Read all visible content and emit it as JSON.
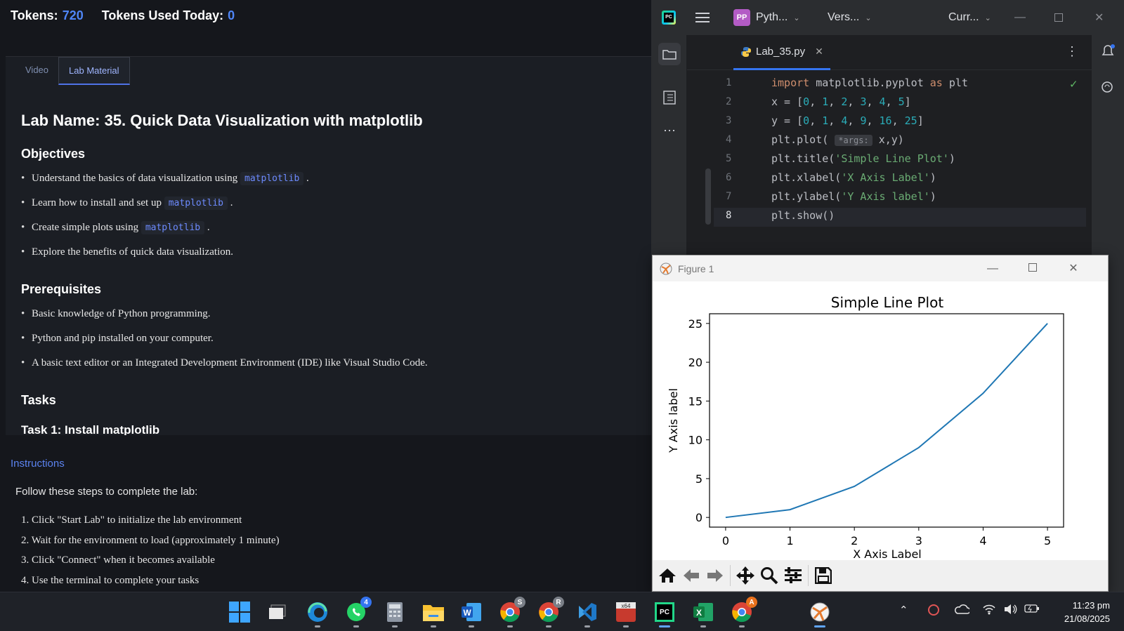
{
  "header": {
    "tokens_label": "Tokens:",
    "tokens_value": "720",
    "used_label": "Tokens Used Today:",
    "used_value": "0"
  },
  "lab": {
    "tabs": [
      "Video",
      "Lab Material"
    ],
    "active_tab": "Lab Material",
    "title": "Lab Name: 35. Quick Data Visualization with matplotlib",
    "objectives_heading": "Objectives",
    "objectives": [
      {
        "text": "Understand the basics of data visualization using",
        "code": "matplotlib",
        "suffix": "."
      },
      {
        "text": "Learn how to install and set up",
        "code": "matplotlib",
        "suffix": "."
      },
      {
        "text": "Create simple plots using",
        "code": "matplotlib",
        "suffix": "."
      },
      {
        "text": "Explore the benefits of quick data visualization.",
        "code": "",
        "suffix": ""
      }
    ],
    "prereq_heading": "Prerequisites",
    "prerequisites": [
      "Basic knowledge of Python programming.",
      "Python and pip installed on your computer.",
      "A basic text editor or an Integrated Development Environment (IDE) like Visual Studio Code."
    ],
    "tasks_heading": "Tasks",
    "task1_heading": "Task 1: Install matplotlib"
  },
  "instructions": {
    "link": "Instructions",
    "lead": "Follow these steps to complete the lab:",
    "steps": [
      "1. Click \"Start Lab\" to initialize the lab environment",
      "2. Wait for the environment to load (approximately 1 minute)",
      "3. Click \"Connect\" when it becomes available",
      "4. Use the terminal to complete your tasks"
    ]
  },
  "ide": {
    "project_badge": "PP",
    "project_name": "Pyth...",
    "vcs": "Vers...",
    "run_config": "Curr...",
    "file_tab": "Lab_35.py",
    "line_numbers": [
      "1",
      "2",
      "3",
      "4",
      "5",
      "6",
      "7",
      "8"
    ],
    "param_hint": "*args:",
    "code": {
      "l1_kw1": "import",
      "l1_mid": " matplotlib.pyplot ",
      "l1_kw2": "as",
      "l1_end": " plt",
      "l4_pre": "plt.plot( ",
      "l4_post": " x,y)",
      "l5": "plt.title(",
      "l5s": "'Simple Line Plot'",
      "l6": "plt.xlabel(",
      "l6s": "'X Axis Label'",
      "l7": "plt.ylabel(",
      "l7s": "'Y Axis label'",
      "l8": "plt.show()"
    },
    "accent": "#3574f0"
  },
  "figure": {
    "window_title": "Figure 1"
  },
  "chart_data": {
    "type": "line",
    "title": "Simple Line Plot",
    "xlabel": "X Axis Label",
    "ylabel": "Y Axis label",
    "x": [
      0,
      1,
      2,
      3,
      4,
      5
    ],
    "y": [
      0,
      1,
      4,
      9,
      16,
      25
    ],
    "xlim": [
      -0.25,
      5.25
    ],
    "ylim": [
      -1.25,
      26.25
    ],
    "xticks": [
      0,
      1,
      2,
      3,
      4,
      5
    ],
    "yticks": [
      0,
      5,
      10,
      15,
      20,
      25
    ],
    "line_color": "#1f77b4",
    "grid": false
  },
  "taskbar": {
    "whatsapp_badge": "4",
    "chrome1_badge": "S",
    "chrome2_badge": "R",
    "chrome3_badge": "A",
    "excel_label": "X",
    "word_label": "W",
    "time": "11:23 pm",
    "date": "21/08/2025"
  }
}
